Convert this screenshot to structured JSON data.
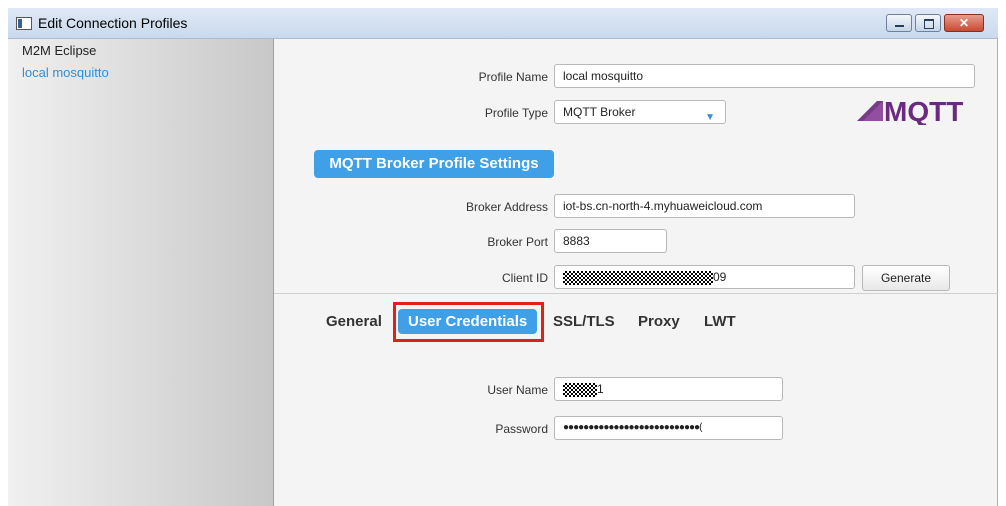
{
  "window": {
    "title": "Edit Connection Profiles",
    "close_symbol": "✕"
  },
  "sidebar": {
    "items": [
      {
        "label": "M2M Eclipse"
      },
      {
        "label": "local mosquitto"
      }
    ]
  },
  "profile": {
    "name_label": "Profile Name",
    "name_value": "local mosquitto",
    "type_label": "Profile Type",
    "type_value": "MQTT Broker",
    "logo_text": "MQTT"
  },
  "broker": {
    "section_label": "MQTT Broker Profile Settings",
    "address_label": "Broker Address",
    "address_value": "iot-bs.cn-north-4.myhuaweicloud.com",
    "port_label": "Broker Port",
    "port_value": "8883",
    "client_id_label": "Client ID",
    "client_id_suffix": "09",
    "generate_label": "Generate"
  },
  "tabs": [
    {
      "label": "General"
    },
    {
      "label": "User Credentials"
    },
    {
      "label": "SSL/TLS"
    },
    {
      "label": "Proxy"
    },
    {
      "label": "LWT"
    }
  ],
  "credentials": {
    "username_label": "User Name",
    "username_suffix": "1",
    "password_label": "Password",
    "password_value": "●●●●●●●●●●●●●●●●●●●●●●●●●●●("
  },
  "colors": {
    "accent": "#3fa0e8",
    "highlight": "#e0201b"
  }
}
